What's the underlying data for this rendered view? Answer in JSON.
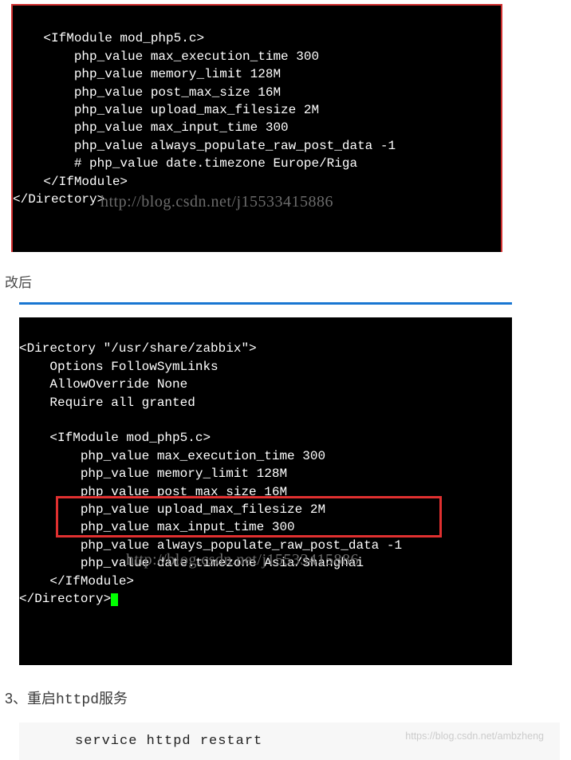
{
  "terminal1": {
    "lines": [
      "    <IfModule mod_php5.c>",
      "        php_value max_execution_time 300",
      "        php_value memory_limit 128M",
      "        php_value post_max_size 16M",
      "        php_value upload_max_filesize 2M",
      "        php_value max_input_time 300",
      "        php_value always_populate_raw_post_data -1",
      "        # php_value date.timezone Europe/Riga",
      "    </IfModule>",
      "</Directory>",
      ""
    ],
    "watermark": "http://blog.csdn.net/j15533415886"
  },
  "label_after": "改后",
  "terminal2": {
    "lines": [
      "<Directory \"/usr/share/zabbix\">",
      "    Options FollowSymLinks",
      "    AllowOverride None",
      "    Require all granted",
      "",
      "    <IfModule mod_php5.c>",
      "        php_value max_execution_time 300",
      "        php_value memory_limit 128M",
      "        php_value post_max_size 16M",
      "        php_value upload_max_filesize 2M",
      "        php_value max_input_time 300",
      "        php_value always_populate_raw_post_data -1",
      "        php_value date.timezone Asia/Shanghai",
      "    </IfModule>"
    ],
    "last_line_prefix": "</Directory>",
    "watermark": "http://blog.csdn.net/j15533415886"
  },
  "step": {
    "num": "3、",
    "text_cn": "重启",
    "text_code": "httpd",
    "text_cn2": "服务"
  },
  "command": "service httpd restart",
  "cmd_watermark": "https://blog.csdn.net/ambzheng"
}
